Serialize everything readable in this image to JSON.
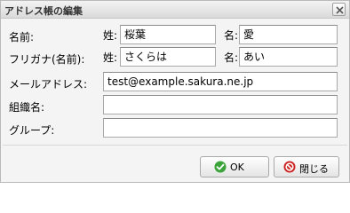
{
  "window": {
    "title": "アドレス帳の編集"
  },
  "form": {
    "name": {
      "label": "名前:",
      "last_prefix": "姓:",
      "last_value": "桜葉",
      "first_prefix": "名:",
      "first_value": "愛"
    },
    "furigana": {
      "label": "フリガナ(名前):",
      "last_prefix": "姓:",
      "last_value": "さくらは",
      "first_prefix": "名:",
      "first_value": "あい"
    },
    "email": {
      "label": "メールアドレス:",
      "value": "test@example.sakura.ne.jp"
    },
    "organization": {
      "label": "組織名:",
      "value": ""
    },
    "group": {
      "label": "グループ:",
      "value": ""
    }
  },
  "buttons": {
    "ok_label": "OK",
    "close_label": "閉じる"
  },
  "colors": {
    "ok_icon": "#3aa33a",
    "close_icon": "#cc2222"
  }
}
